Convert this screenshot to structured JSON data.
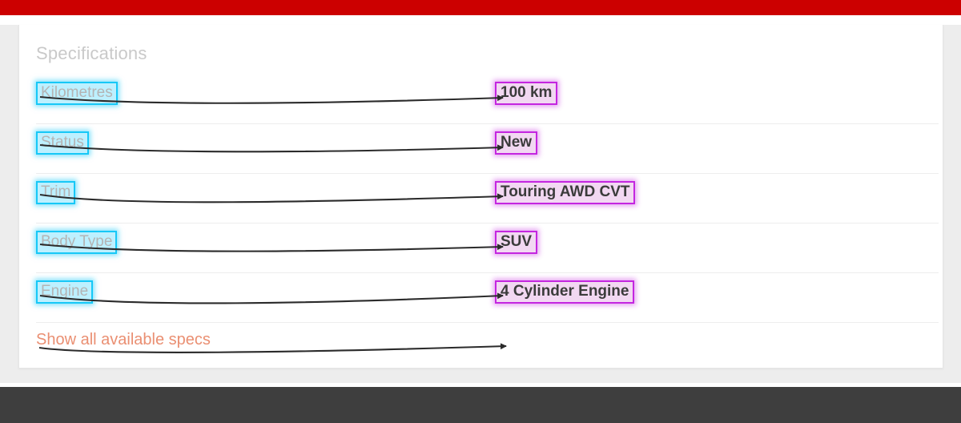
{
  "banner": {
    "color": "#cc0000"
  },
  "card": {
    "heading": "Specifications"
  },
  "specs": {
    "rows": [
      {
        "label": "Kilometres",
        "value": "100 km"
      },
      {
        "label": "Status",
        "value": "New"
      },
      {
        "label": "Trim",
        "value": "Touring AWD CVT"
      },
      {
        "label": "Body Type",
        "value": "SUV"
      },
      {
        "label": "Engine",
        "value": "4 Cylinder Engine"
      }
    ],
    "show_all_label": "Show all available specs"
  },
  "annotations": {
    "label_highlight_color": "#17c8f7",
    "value_highlight_color": "#c426e0",
    "arrow_color": "#2b2b2b",
    "link_color": "#ea8f72",
    "heading_color": "#c9c9c9"
  },
  "footer": {
    "color": "#3e3e3e"
  }
}
